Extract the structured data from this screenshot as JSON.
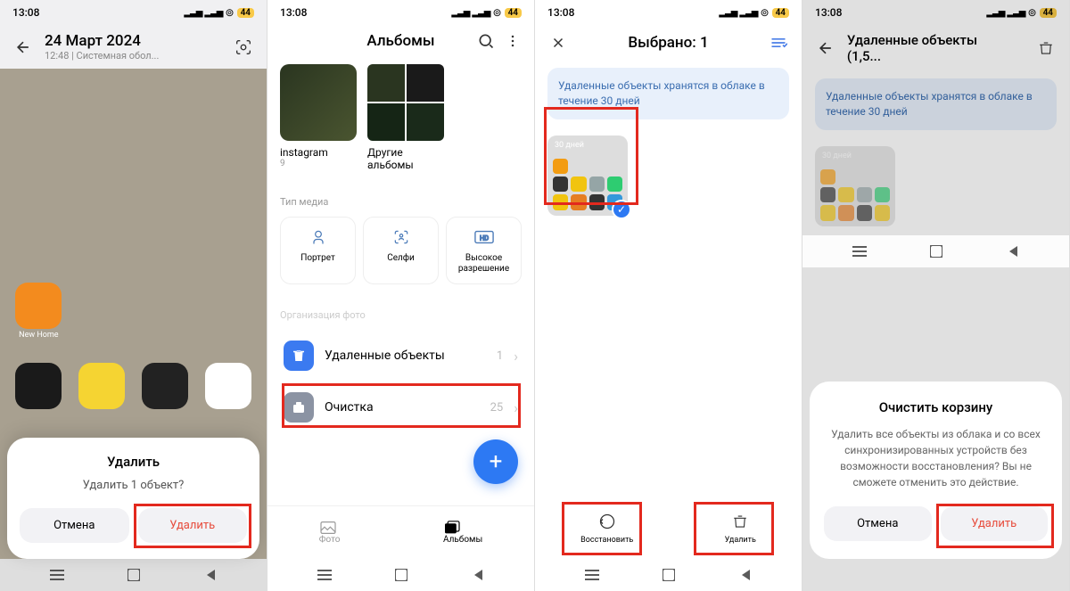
{
  "status": {
    "time": "13:08",
    "battery": "44"
  },
  "p1": {
    "title": "24 Март 2024",
    "sub": "12:48 | Системная обол...",
    "sheet": {
      "title": "Удалить",
      "msg": "Удалить 1 объект?",
      "cancel": "Отмена",
      "delete": "Удалить"
    },
    "apps": [
      {
        "label": "New Home",
        "bg": "#f38b1e"
      }
    ]
  },
  "p2": {
    "title": "Альбомы",
    "albums": [
      {
        "name": "instagram",
        "count": "9"
      },
      {
        "name": "Другие альбомы",
        "count": ""
      }
    ],
    "section_media": "Тип медиа",
    "media": [
      {
        "label": "Портрет"
      },
      {
        "label": "Селфи"
      },
      {
        "label": "Высокое разрешение"
      }
    ],
    "section_org": "Организация фото",
    "items": [
      {
        "label": "Удаленные объекты",
        "count": "1",
        "bg": "#3b7af0"
      },
      {
        "label": "Очистка",
        "count": "25",
        "bg": "#8b93a3"
      }
    ],
    "tabs": [
      {
        "label": "Фото"
      },
      {
        "label": "Альбомы"
      }
    ]
  },
  "p3": {
    "title": "Выбрано: 1",
    "banner": "Удаленные объекты хранятся в облаке в течение 30 дней",
    "thumb": "30 дней",
    "actions": [
      {
        "label": "Восстановить"
      },
      {
        "label": "Удалить"
      }
    ]
  },
  "p4": {
    "title": "Удаленные объекты (1,5...",
    "banner": "Удаленные объекты хранятся в облаке в течение 30 дней",
    "thumb": "30 дней",
    "sheet": {
      "title": "Очистить корзину",
      "msg": "Удалить все объекты из облака и со всех синхронизированных устройств без возможности восстановления? Вы не сможете отменить это действие.",
      "cancel": "Отмена",
      "delete": "Удалить"
    }
  }
}
